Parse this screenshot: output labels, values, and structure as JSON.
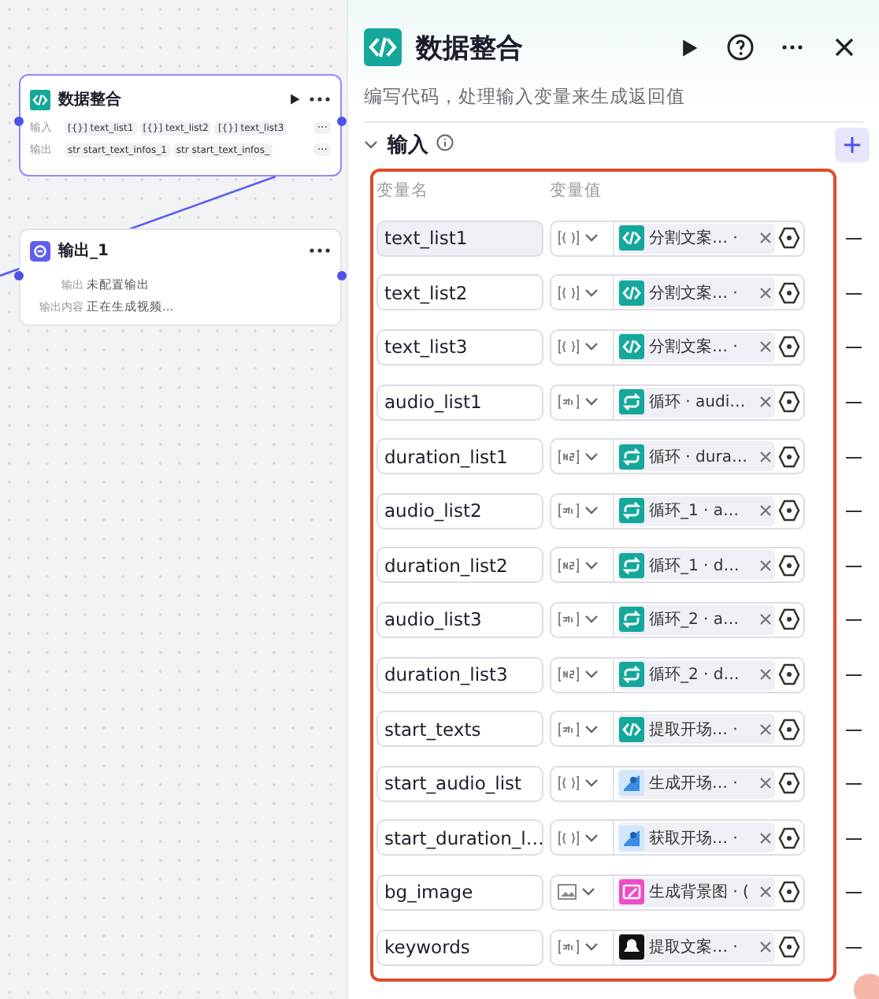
{
  "canvas": {
    "nodes": [
      {
        "title": "数据整合",
        "kind": "code",
        "run": true,
        "rows": [
          {
            "label": "输入",
            "tags": [
              {
                "type": "[{}]",
                "text": "text_list1"
              },
              {
                "type": "[{}]",
                "text": "text_list2"
              },
              {
                "type": "[{}]",
                "text": "text_list3"
              }
            ],
            "more": "···"
          },
          {
            "label": "输出",
            "tags": [
              {
                "type": "str",
                "text": "start_text_infos_1"
              },
              {
                "type": "str",
                "text": "start_text_infos_"
              }
            ],
            "more": "···"
          }
        ],
        "selected": true
      },
      {
        "title": "输出_1",
        "kind": "output",
        "run": false,
        "fields": [
          {
            "label": "输出",
            "value": "未配置输出"
          },
          {
            "label": "输出内容",
            "value": "正在生成视频..."
          }
        ],
        "selected": false
      }
    ]
  },
  "panel": {
    "title": "数据整合",
    "description": "编写代码，处理输入变量来生成返回值",
    "section": {
      "title": "输入",
      "expanded": true
    },
    "columns": [
      "变量名",
      "变量值"
    ],
    "rows": [
      {
        "name": "text_list1",
        "type": {
          "kind": "array_object"
        },
        "ref": {
          "kind": "code",
          "text": "分割文案… ·"
        },
        "focused": true
      },
      {
        "name": "text_list2",
        "type": {
          "kind": "array_object"
        },
        "ref": {
          "kind": "code",
          "text": "分割文案… ·"
        },
        "focused": false
      },
      {
        "name": "text_list3",
        "type": {
          "kind": "array_object"
        },
        "ref": {
          "kind": "code",
          "text": "分割文案… ·"
        },
        "focused": false
      },
      {
        "name": "audio_list1",
        "type": {
          "kind": "array_string"
        },
        "ref": {
          "kind": "loop",
          "text": "循环 · audi…"
        },
        "focused": false
      },
      {
        "name": "duration_list1",
        "type": {
          "kind": "array_number"
        },
        "ref": {
          "kind": "loop",
          "text": "循环 · dura…"
        },
        "focused": false
      },
      {
        "name": "audio_list2",
        "type": {
          "kind": "array_string"
        },
        "ref": {
          "kind": "loop",
          "text": "循环_1 · a…"
        },
        "focused": false
      },
      {
        "name": "duration_list2",
        "type": {
          "kind": "array_number"
        },
        "ref": {
          "kind": "loop",
          "text": "循环_1 · d…"
        },
        "focused": false
      },
      {
        "name": "audio_list3",
        "type": {
          "kind": "array_string"
        },
        "ref": {
          "kind": "loop",
          "text": "循环_2 · a…"
        },
        "focused": false
      },
      {
        "name": "duration_list3",
        "type": {
          "kind": "array_number"
        },
        "ref": {
          "kind": "loop",
          "text": "循环_2 · d…"
        },
        "focused": false
      },
      {
        "name": "start_texts",
        "type": {
          "kind": "array_string"
        },
        "ref": {
          "kind": "code",
          "text": "提取开场… ·"
        },
        "focused": false
      },
      {
        "name": "start_audio_list",
        "type": {
          "kind": "array_object"
        },
        "ref": {
          "kind": "tts",
          "text": "生成开场… ·"
        },
        "focused": false
      },
      {
        "name": "start_duration_l…",
        "type": {
          "kind": "array_object"
        },
        "ref": {
          "kind": "tts",
          "text": "获取开场… ·"
        },
        "focused": false
      },
      {
        "name": "bg_image",
        "type": {
          "kind": "image"
        },
        "ref": {
          "kind": "imagegen",
          "text": "生成背景图 · ("
        },
        "focused": false
      },
      {
        "name": "keywords",
        "type": {
          "kind": "array_string"
        },
        "ref": {
          "kind": "app",
          "text": "提取文案… ·"
        },
        "focused": false
      }
    ]
  }
}
